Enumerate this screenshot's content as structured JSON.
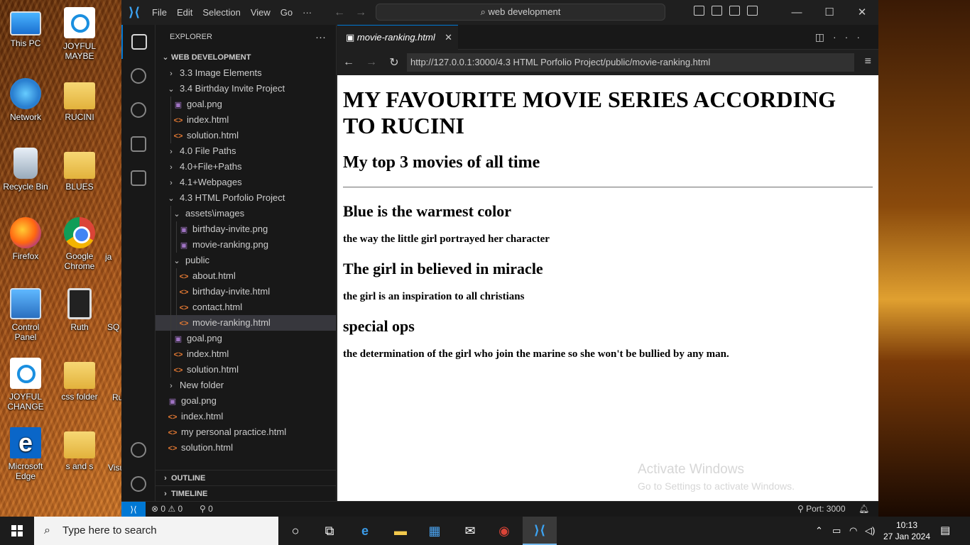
{
  "desktop": {
    "icons": [
      {
        "label": "This PC"
      },
      {
        "label": "JOYFUL MAYBE"
      },
      {
        "label": "Network"
      },
      {
        "label": "RUCINI"
      },
      {
        "label": "Recycle Bin"
      },
      {
        "label": "BLUES"
      },
      {
        "label": "Firefox"
      },
      {
        "label": "Google Chrome"
      },
      {
        "label": "Control Panel"
      },
      {
        "label": "Ruth"
      },
      {
        "label": "JOYFUL CHANGE"
      },
      {
        "label": "css folder"
      },
      {
        "label": "Microsoft Edge"
      },
      {
        "label": "s and s"
      },
      {
        "label": "ja"
      },
      {
        "label": "SQ"
      },
      {
        "label": "Ru"
      },
      {
        "label": "Visu"
      }
    ]
  },
  "vscode": {
    "menu": [
      "File",
      "Edit",
      "Selection",
      "View",
      "Go",
      "···"
    ],
    "search": "web development",
    "explorer_title": "EXPLORER",
    "workspace": "WEB DEVELOPMENT",
    "tree": [
      {
        "label": "3.3 Image Elements",
        "type": "folder",
        "open": false
      },
      {
        "label": "3.4 Birthday Invite Project",
        "type": "folder",
        "open": true
      },
      {
        "label": "goal.png",
        "type": "png"
      },
      {
        "label": "index.html",
        "type": "html"
      },
      {
        "label": "solution.html",
        "type": "html"
      },
      {
        "label": "4.0 File Paths",
        "type": "folder",
        "open": false
      },
      {
        "label": "4.0+File+Paths",
        "type": "folder",
        "open": false
      },
      {
        "label": "4.1+Webpages",
        "type": "folder",
        "open": false
      },
      {
        "label": "4.3 HTML Porfolio Project",
        "type": "folder",
        "open": true
      },
      {
        "label": "assets\\images",
        "type": "folder",
        "open": true
      },
      {
        "label": "birthday-invite.png",
        "type": "png"
      },
      {
        "label": "movie-ranking.png",
        "type": "png"
      },
      {
        "label": "public",
        "type": "folder",
        "open": true
      },
      {
        "label": "about.html",
        "type": "html"
      },
      {
        "label": "birthday-invite.html",
        "type": "html"
      },
      {
        "label": "contact.html",
        "type": "html"
      },
      {
        "label": "movie-ranking.html",
        "type": "html"
      },
      {
        "label": "goal.png",
        "type": "png"
      },
      {
        "label": "index.html",
        "type": "html"
      },
      {
        "label": "solution.html",
        "type": "html"
      },
      {
        "label": "New folder",
        "type": "folder",
        "open": false
      },
      {
        "label": "goal.png",
        "type": "png"
      },
      {
        "label": "index.html",
        "type": "html"
      },
      {
        "label": "my personal practice.html",
        "type": "html"
      },
      {
        "label": "solution.html",
        "type": "html"
      }
    ],
    "outline": "OUTLINE",
    "timeline": "TIMELINE",
    "tab_name": "movie-ranking.html",
    "url": "http://127.0.0.1:3000/4.3 HTML Porfolio Project/public/movie-ranking.html",
    "status": {
      "problems": "⊗ 0 ⚠ 0",
      "ports_count": "0",
      "port": "Port: 3000"
    }
  },
  "page": {
    "h1": "MY FAVOURITE MOVIE SERIES ACCORDING TO RUCINI",
    "h2": "My top 3 movies of all time",
    "movies": [
      {
        "title": "Blue is the warmest color",
        "desc": "the way the little girl portrayed her character"
      },
      {
        "title": "The girl in believed in miracle",
        "desc": "the girl is an inspiration to all christians"
      },
      {
        "title": "special ops",
        "desc": "the determination of the girl who join the marine so she won't be bullied by any man."
      }
    ]
  },
  "watermark": {
    "line1": "Activate Windows",
    "line2": "Go to Settings to activate Windows."
  },
  "taskbar": {
    "search_placeholder": "Type here to search",
    "time": "10:13",
    "date": "27 Jan 2024"
  },
  "colors": {
    "accent": "#0078d4",
    "html_icon": "#e37933",
    "png_icon": "#a074c4"
  }
}
